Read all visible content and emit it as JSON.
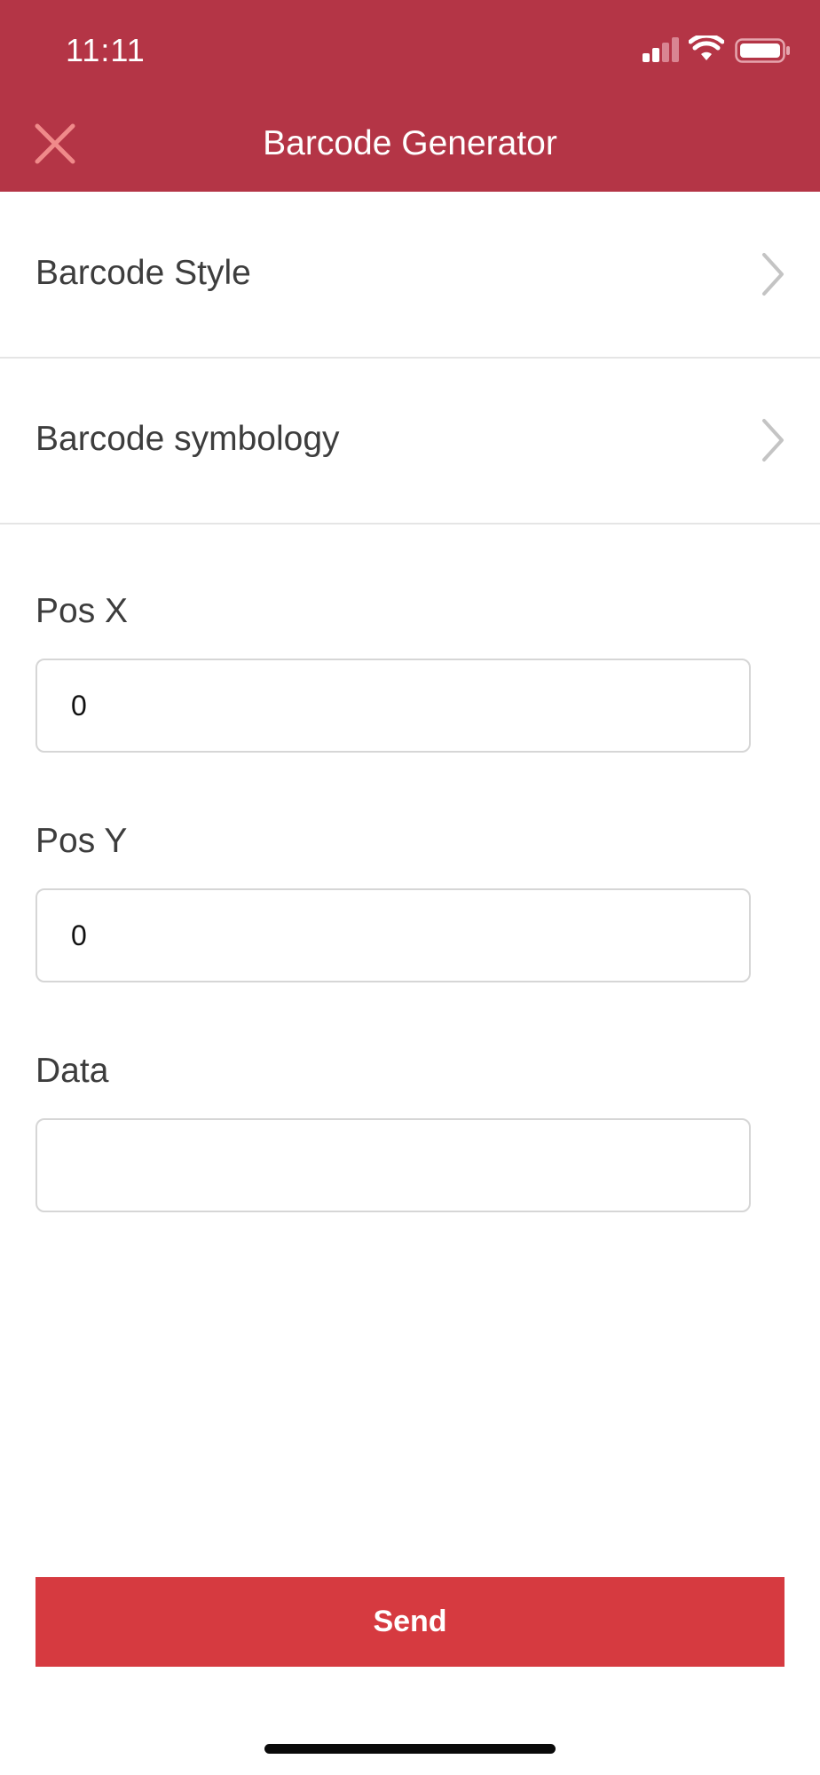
{
  "status_bar": {
    "time": "11:11",
    "signal_icon": "signal-icon",
    "wifi_icon": "wifi-icon",
    "battery_icon": "battery-icon"
  },
  "nav": {
    "title": "Barcode Generator",
    "close_icon": "close-icon"
  },
  "menu": {
    "items": [
      {
        "label": "Barcode Style",
        "icon": "chevron-right-icon"
      },
      {
        "label": "Barcode symbology",
        "icon": "chevron-right-icon"
      }
    ]
  },
  "form": {
    "pos_x": {
      "label": "Pos X",
      "value": "0"
    },
    "pos_y": {
      "label": "Pos Y",
      "value": "0"
    },
    "data": {
      "label": "Data",
      "value": ""
    }
  },
  "actions": {
    "send_label": "Send"
  },
  "colors": {
    "header_background": "#b43546",
    "send_button": "#d63a40",
    "close_icon": "#f08a8a"
  }
}
